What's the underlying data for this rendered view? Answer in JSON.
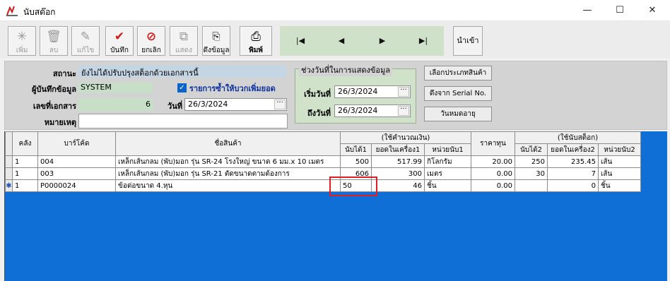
{
  "window": {
    "title": "นับสต๊อก"
  },
  "toolbar": {
    "buttons": [
      {
        "label": "เพิ่ม",
        "icon": "add-icon",
        "enabled": false
      },
      {
        "label": "ลบ",
        "icon": "trash-icon",
        "enabled": false
      },
      {
        "label": "แก้ไข",
        "icon": "edit-icon",
        "enabled": false
      },
      {
        "label": "บันทึก",
        "icon": "check-icon",
        "enabled": true
      },
      {
        "label": "ยกเลิก",
        "icon": "cancel-icon",
        "enabled": true
      },
      {
        "label": "แสดง",
        "icon": "show-icon",
        "enabled": false
      },
      {
        "label": "ดึงข้อมูล",
        "icon": "fetch-icon",
        "enabled": true
      },
      {
        "label": "พิมพ์",
        "icon": "print-icon",
        "enabled": true
      }
    ],
    "nav": [
      "|◀",
      "◀",
      "▶",
      "▶|"
    ],
    "import_label": "นำเข้า"
  },
  "form": {
    "status_label": "สถานะ",
    "status_value": "ยังไม่ได้ปรับปรุงสต็อกด้วยเอกสารนี้",
    "recorder_label": "ผู้บันทึกข้อมูล",
    "recorder_value": "SYSTEM",
    "docno_label": "เลขที่เอกสาร",
    "docno_value": "6",
    "note_label": "หมายเหตุ",
    "note_value": "",
    "checkbox_label": "รายการซ้ำให้บวกเพิ่มยอด",
    "date_label": "วันที่",
    "date_value": "26/3/2024"
  },
  "range_group": {
    "title": "ช่วงวันที่ในการแสดงข้อมูล",
    "start_label": "เริ่มวันที่",
    "start_value": "26/3/2024",
    "end_label": "ถึงวันที่",
    "end_value": "26/3/2024"
  },
  "side_buttons": {
    "category": "เลือกประเภทสินค้า",
    "serial": "ดึงจาก Serial No.",
    "expiry": "วันหมดอายุ"
  },
  "grid": {
    "headers": {
      "store": "คลัง",
      "barcode": "บาร์โค้ด",
      "name": "ชื่อสินค้า",
      "group1": "(ใช้คำนวณเงิน)",
      "count1": "นับได้1",
      "machine1": "ยอดในเครื่อง1",
      "unit1": "หน่วยนับ1",
      "cost": "ราคาทุน",
      "group2": "(ใช้นับสต็อก)",
      "count2": "นับได้2",
      "machine2": "ยอดในเครื่อง2",
      "unit2": "หน่วยนับ2"
    },
    "rows": [
      {
        "marker": "",
        "store": "1",
        "barcode": "004",
        "name": "เหล็กเส้นกลม (พับ)มอก รุ่น SR-24 โรงใหญ่ ขนาด 6 มม.x 10 เมตร",
        "count1": "500",
        "machine1": "517.99",
        "unit1": "กิโลกรัม",
        "cost": "20.00",
        "count2": "250",
        "machine2": "235.45",
        "unit2": "เส้น"
      },
      {
        "marker": "",
        "store": "1",
        "barcode": "003",
        "name": "เหล็กเส้นกลม (พับ)มอก รุ่น SR-21 ตัดขนาดตามต้องการ",
        "count1": "606",
        "machine1": "300",
        "unit1": "เมตร",
        "cost": "0.00",
        "count2": "30",
        "machine2": "7",
        "unit2": "เส้น"
      },
      {
        "marker": "✱",
        "store": "1",
        "barcode": "P0000024",
        "name": "ข้อต่อขนาด 4.หุน",
        "count1": "50",
        "machine1": "46",
        "unit1": "ชิ้น",
        "cost": "0.00",
        "count2": "",
        "machine2": "0",
        "unit2": "ชิ้น"
      }
    ]
  },
  "colors": {
    "grid_background": "#0f6fd7",
    "highlight": "#e02020",
    "status_field": "#c4d5e4",
    "readonly_field": "#c6dfc6"
  }
}
